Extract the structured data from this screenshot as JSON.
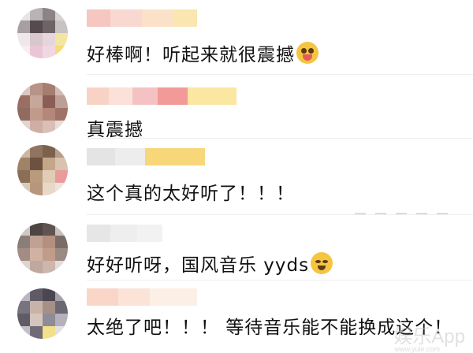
{
  "comments": [
    {
      "text": "好棒啊！听起来就很震撼",
      "emoji": "scream-face-emoji"
    },
    {
      "text": "真震撼"
    },
    {
      "text": "这个真的太好听了！！！"
    },
    {
      "text": "好好听呀，国风音乐 yyds",
      "emoji": "teary-face-emoji"
    },
    {
      "text": "太绝了吧！！！ 等待音乐能不能换成这个！"
    }
  ],
  "watermark": {
    "main": "娱乐App",
    "sub": "www.yule.com"
  },
  "colors": {
    "text": "#111111",
    "name_pink": "#f7c9c9",
    "name_gold": "#f8dc8a",
    "emoji_yellow": "#f5c542"
  }
}
